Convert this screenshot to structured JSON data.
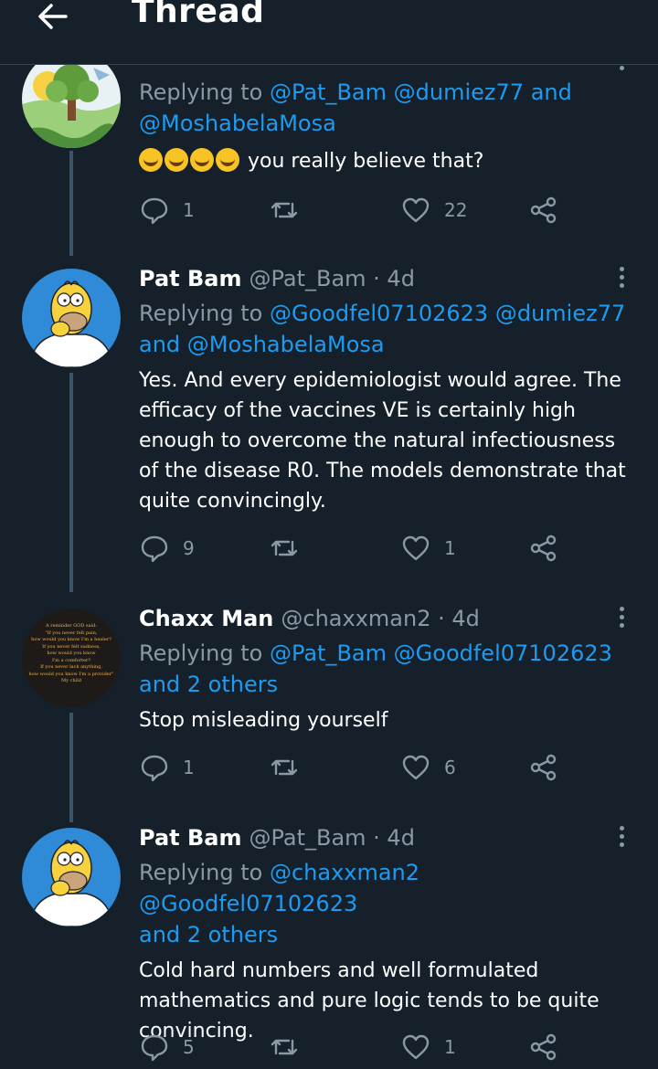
{
  "header": {
    "title": "Thread"
  },
  "tweets": [
    {
      "name": "",
      "handle": "",
      "time": "",
      "reply_label": "Replying to",
      "mentions": [
        "@Pat_Bam",
        "@dumiez77",
        "@MoshabelaMosa"
      ],
      "mention_joiner": "and",
      "body": "you really believe that?",
      "emoji_count": 4,
      "reply_count": "1",
      "retweet_count": "",
      "like_count": "22",
      "avatar": "landscape-tree-avatar"
    },
    {
      "name": "Pat Bam",
      "handle": "@Pat_Bam",
      "time": "· 4d",
      "reply_label": "Replying to",
      "mentions": [
        "@Goodfel07102623",
        "@dumiez77",
        "@MoshabelaMosa"
      ],
      "mention_joiner": "and",
      "body": "Yes. And every epidemiologist would agree. The efficacy of the vaccines VE is certainly high enough to overcome the natural infectiousness of the disease R0.  The models demonstrate that quite convincingly.",
      "reply_count": "9",
      "retweet_count": "",
      "like_count": "1",
      "avatar": "homer-avatar"
    },
    {
      "name": "Chaxx Man",
      "handle": "@chaxxman2",
      "time": "· 4d",
      "reply_label": "Replying to",
      "mentions": [
        "@Pat_Bam",
        "@Goodfel07102623"
      ],
      "others": "and 2 others",
      "body": "Stop misleading yourself",
      "reply_count": "1",
      "retweet_count": "",
      "like_count": "6",
      "avatar": "text-quote-avatar",
      "avatar_lines": [
        "A reminder GOD said:",
        "\"If you never felt pain,",
        "how would you know I'm a healer?",
        "If you never felt sadness,",
        "how would you know",
        "I'm a comforter?",
        "If you never lack anything,",
        "how would you know I'm a provider\"",
        "My child"
      ]
    },
    {
      "name": "Pat Bam",
      "handle": "@Pat_Bam",
      "time": "· 4d",
      "reply_label": "Replying to",
      "mentions": [
        "@chaxxman2",
        "@Goodfel07102623"
      ],
      "others": "and 2 others",
      "body": "Cold hard numbers and well formulated mathematics and pure logic tends to be quite convincing.",
      "reply_count": "5",
      "retweet_count": "",
      "like_count": "1",
      "avatar": "homer-avatar"
    }
  ],
  "colors": {
    "background": "#15202b",
    "accent": "#1d9bf0",
    "muted": "#8b98a5",
    "thread_line": "#3d5466"
  },
  "icons": {
    "back": "arrow-left-icon",
    "reply": "reply-bubble-icon",
    "retweet": "retweet-icon",
    "like": "heart-icon",
    "share": "share-icon",
    "more": "more-vertical-icon"
  }
}
